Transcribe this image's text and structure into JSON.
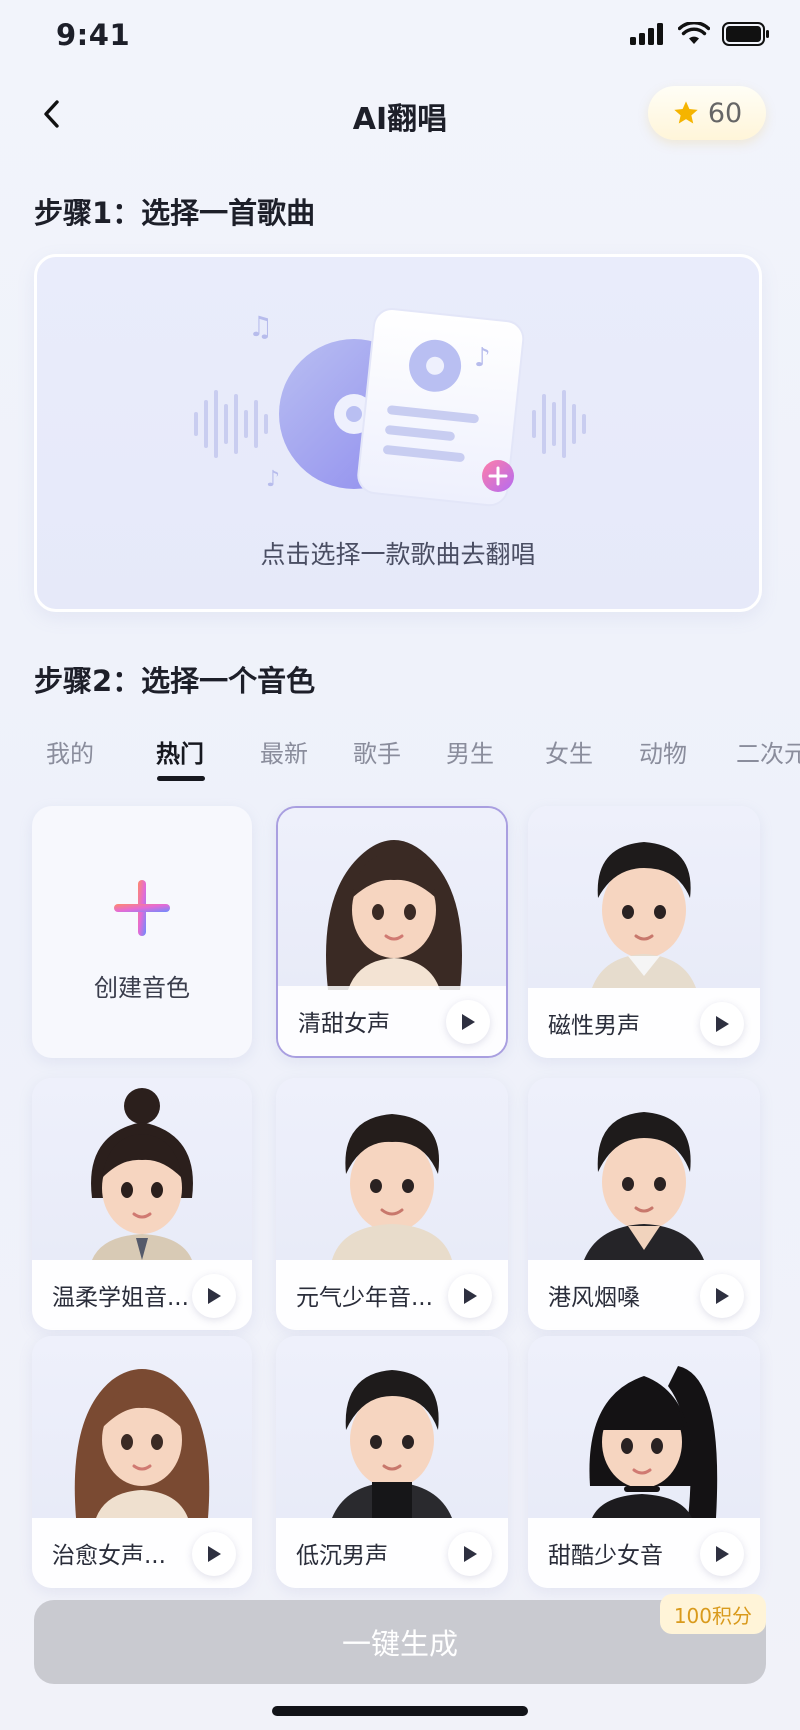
{
  "status": {
    "time": "9:41"
  },
  "nav": {
    "title": "AI翻唱",
    "credits": "60"
  },
  "step1": {
    "title": "步骤1：选择一首歌曲",
    "picker_text": "点击选择一款歌曲去翻唱"
  },
  "step2": {
    "title": "步骤2：选择一个音色",
    "tabs": [
      "我的",
      "热门",
      "最新",
      "歌手",
      "男生",
      "女生",
      "动物",
      "二次元"
    ],
    "active_tab": "热门"
  },
  "voices": {
    "create_label": "创建音色",
    "items": [
      {
        "label": "清甜女声",
        "selected": true
      },
      {
        "label": "磁性男声"
      },
      {
        "label": "温柔学姐音..."
      },
      {
        "label": "元气少年音..."
      },
      {
        "label": "港风烟嗓"
      },
      {
        "label": "治愈女声..."
      },
      {
        "label": "低沉男声"
      },
      {
        "label": "甜酷少女音"
      }
    ]
  },
  "footer": {
    "generate_label": "一键生成",
    "cost": "100积分"
  },
  "colors": {
    "accent": "#a99fe0",
    "star": "#f5b400",
    "button_disabled": "#c9cad0"
  }
}
